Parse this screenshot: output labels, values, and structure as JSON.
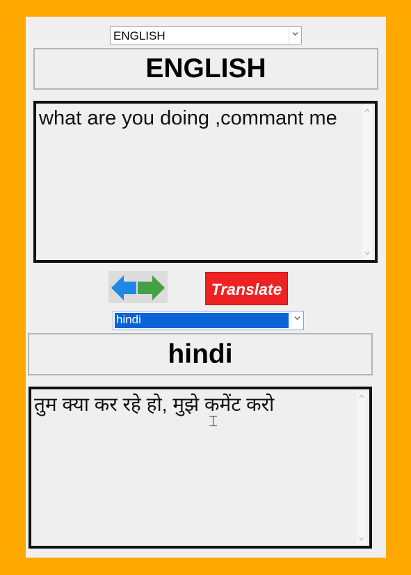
{
  "source": {
    "language_select": "ENGLISH",
    "language_label": "ENGLISH",
    "text": "what are you doing ,commant me"
  },
  "controls": {
    "swap_icon": "swap-arrows-icon",
    "translate_label": "Translate",
    "colors": {
      "translate_bg": "#ee2222",
      "swap_left": "#1e88e5",
      "swap_right": "#43a047",
      "background": "#FFA800"
    }
  },
  "target": {
    "language_select": "hindi",
    "language_label": "hindi",
    "text": "तुम क्या कर रहे हो, मुझे कमेंट करो"
  }
}
